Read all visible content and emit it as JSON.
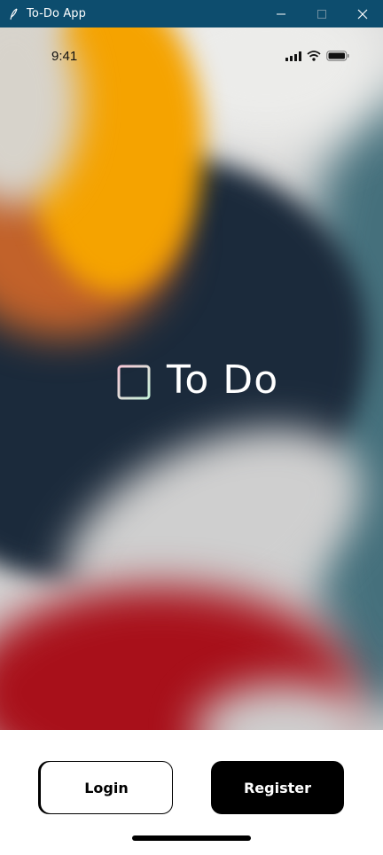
{
  "window": {
    "title": "To-Do App",
    "controls": [
      "minimize",
      "maximize",
      "close"
    ]
  },
  "status_bar": {
    "time": "9:41",
    "icons": [
      "signal-icon",
      "wifi-icon",
      "battery-icon"
    ]
  },
  "logo": {
    "icon": "notepad-icon",
    "name": "To Do"
  },
  "actions": {
    "login_label": "Login",
    "register_label": "Register"
  },
  "colors": {
    "titlebar": "#0d4d6e",
    "primary_button": "#000000",
    "accent_orange": "#f5a300",
    "accent_navy": "#1b2a3b",
    "accent_red": "#b0101a",
    "accent_teal": "#3f6b78"
  }
}
